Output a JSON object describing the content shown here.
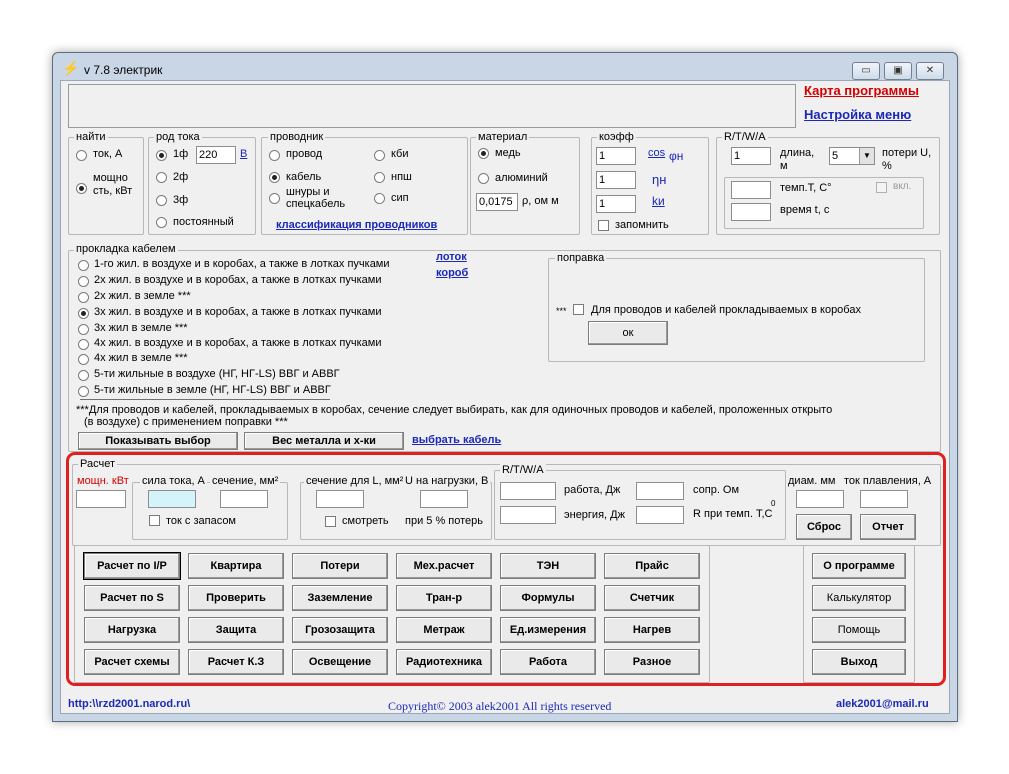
{
  "window": {
    "title": "v 7.8 электрик",
    "controls": {
      "min": "▭",
      "max": "▣",
      "close": "✕"
    }
  },
  "top_links": {
    "map": "Карта программы",
    "settings": "Настройка меню"
  },
  "find": {
    "label": "найти",
    "opt1": "ток, А",
    "opt2": "мощно сть, кВт"
  },
  "current": {
    "label": "род тока",
    "opt1": "1ф",
    "voltage": "220",
    "unit": "В",
    "opt2": "2ф",
    "opt3": "3ф",
    "opt4": "постоянный"
  },
  "conductor": {
    "label": "проводник",
    "wire": "провод",
    "cable": "кабель",
    "cords": "шнуры и спецкабель",
    "kbi": "кби",
    "npsh": "нпш",
    "sip": "сип",
    "link": "классификация проводников"
  },
  "material": {
    "label": "материал",
    "copper": "медь",
    "aluminum": "алюминий",
    "rho_value": "0,0175",
    "rho_label": "ρ, ом м"
  },
  "coef": {
    "label": "коэфф",
    "v1": "1",
    "cos": "cos",
    "phi": "φн",
    "v2": "1",
    "eta": "ηн",
    "v3": "1",
    "k": "kи",
    "remember": "запомнить"
  },
  "rtwa_top": {
    "label": "R/T/W/A",
    "value": "1",
    "length": "длина, м",
    "select": "5",
    "losses": "потери U, %",
    "temp": "темп.T, C°",
    "enable": "вкл.",
    "time": "время t, с"
  },
  "laying": {
    "label": "прокладка кабелем",
    "options": [
      "1-го жил. в воздухе и в коробах, а также в лотках пучками",
      "2х жил. в воздухе и в коробах, а также в лотках пучками",
      "2х жил. в земле ***",
      "3х жил. в воздухе и в коробах, а также в лотках пучками",
      "3х жил в земле ***",
      "4х жил. в воздухе и в коробах, а также в лотках пучками",
      "4х жил в земле ***",
      "5-ти жильные в воздухе (НГ, НГ-LS) ВВГ и АВВГ",
      "5-ти жильные в земле (НГ, НГ-LS) ВВГ и АВВГ"
    ],
    "link_tray": "лоток",
    "link_box": "короб",
    "note1": "***Для проводов и кабелей, прокладываемых в коробах, сечение следует выбирать, как для одиночных проводов и кабелей, проложенных открыто",
    "note2": "(в воздухе) с применением поправки ***"
  },
  "correction": {
    "label": "поправка",
    "stars": "***",
    "text": "Для проводов и кабелей прокладываемых в коробах",
    "ok": "ок"
  },
  "bottom_bar": {
    "show": "Показывать выбор",
    "metal": "Вес металла и х-ки",
    "choose": "выбрать кабель"
  },
  "calc": {
    "label": "Расчет",
    "power": "мощн. кВт",
    "current_label": "сила тока, А",
    "section_label": "сечение, мм²",
    "reserve": "ток с запасом",
    "section_lu": "сечение для L, мм²",
    "u_load": "U на нагрузки, В",
    "watch": "смотреть",
    "at5": "при 5 % потерь",
    "rtwa": "R/T/W/A",
    "work": "работа, Дж",
    "energy": "энергия, Дж",
    "resist": "сопр. Ом",
    "rtemp": "R при темп. T,C",
    "rtemp_sup": "0",
    "diam": "диам. мм",
    "melt": "ток плавления, А",
    "reset": "Сброс",
    "report": "Отчет"
  },
  "buttons": [
    [
      "Расчет по I/P",
      "Квартира",
      "Потери",
      "Мех.расчет",
      "ТЭН",
      "Прайс"
    ],
    [
      "Расчет по S",
      "Проверить",
      "Заземление",
      "Тран-р",
      "Формулы",
      "Счетчик"
    ],
    [
      "Нагрузка",
      "Защита",
      "Грозозащита",
      "Метраж",
      "Ед.измерения",
      "Нагрев"
    ],
    [
      "Расчет схемы",
      "Расчет К.З",
      "Освещение",
      "Радиотехника",
      "Работа",
      "Разное"
    ]
  ],
  "side_buttons": {
    "about": "О программе",
    "calc": "Калькулятор",
    "help": "Помощь",
    "exit": "Выход"
  },
  "footer": {
    "site": "http:\\\\rzd2001.narod.ru\\",
    "copyright": "Copyright© 2003 alek2001 All rights reserved",
    "email": "alek2001@mail.ru"
  },
  "colors": {
    "highlight": "#e02020",
    "link": "#1b28b8",
    "accent_red": "#d40000"
  }
}
